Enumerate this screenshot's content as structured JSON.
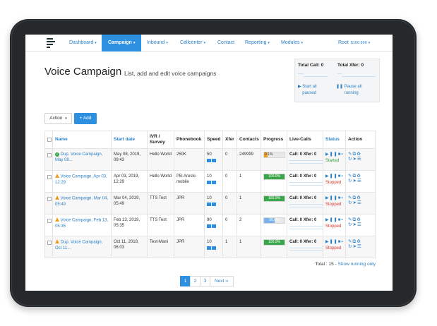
{
  "nav": {
    "items": [
      {
        "label": "Dashboard",
        "caret": true
      },
      {
        "label": "Campaign",
        "caret": true,
        "active": true
      },
      {
        "label": "Inbound",
        "caret": true
      },
      {
        "label": "Callcenter",
        "caret": true
      },
      {
        "label": "Contact",
        "caret": false
      },
      {
        "label": "Reporting",
        "caret": true
      },
      {
        "label": "Modules",
        "caret": true
      }
    ],
    "user": "Root",
    "balance": "$100.999"
  },
  "header": {
    "title": "Voice Campaign",
    "subtitle": "List, add and edit voice campaigns"
  },
  "stats": {
    "total_call_label": "Total Call: 0",
    "total_xfer_label": "Total Xfer: 0",
    "start_all": "Start all paused",
    "pause_all": "Pause all running"
  },
  "toolbar": {
    "action_label": "Action",
    "add_label": "+ Add"
  },
  "table": {
    "headers": [
      "Name",
      "Start date",
      "IVR / Survey",
      "Phonebook",
      "Speed",
      "Xfer",
      "Contacts",
      "Progress",
      "Live-Calls",
      "Status",
      "Action"
    ],
    "rows": [
      {
        "status_icon": "check-icon",
        "name": "Dup. Voice Campaign, May 08...",
        "start_date": "May 08, 2019, 09:43",
        "ivr": "Hello World",
        "phonebook": "250K",
        "speed": "50",
        "xfer": "0",
        "contacts": "249999",
        "progress": 0.1,
        "progress_label": "0.1%",
        "call": "Call: 0",
        "xfer_live": "Xfer: 0",
        "status": "Started",
        "status_kind": "ok"
      },
      {
        "status_icon": "warning-icon",
        "name": "Voice Campaign, Apr 03, 12:29",
        "start_date": "Apr 03, 2019, 12:29",
        "ivr": "Hello World",
        "phonebook": "PB-Areski-mobile",
        "speed": "10",
        "xfer": "0",
        "contacts": "1",
        "progress": 100.0,
        "progress_label": "100.0%",
        "call": "Call: 0",
        "xfer_live": "Xfer: 0",
        "status": "Stopped",
        "status_kind": "stop"
      },
      {
        "status_icon": "warning-icon",
        "name": "Voice Campaign, Mar 04, 05:49",
        "start_date": "Mar 04, 2019, 05:49",
        "ivr": "TTS Test",
        "phonebook": "JPR",
        "speed": "10",
        "xfer": "0",
        "contacts": "1",
        "progress": 100.0,
        "progress_label": "100.0%",
        "call": "Call: 0",
        "xfer_live": "Xfer: 0",
        "status": "Stopped",
        "status_kind": "stop"
      },
      {
        "status_icon": "warning-icon",
        "name": "Voice Campaign, Feb 13, 05:35",
        "start_date": "Feb 13, 2019, 05:35",
        "ivr": "TTS Test",
        "phonebook": "JPR",
        "speed": "90",
        "xfer": "0",
        "contacts": "2",
        "progress": 50.0,
        "progress_label": "50.0%",
        "call": "Call: 0",
        "xfer_live": "Xfer: 0",
        "status": "Stopped",
        "status_kind": "stop"
      },
      {
        "status_icon": "warning-icon",
        "name": "Dup. Voice Campaign, Oct 11...",
        "start_date": "Oct 11, 2018, 06:03",
        "ivr": "Test-Mani",
        "phonebook": "JPR",
        "speed": "10",
        "xfer": "1",
        "contacts": "1",
        "progress": 100.0,
        "progress_label": "100.0%",
        "call": "Call: 0",
        "xfer_live": "Xfer: 0",
        "status": "Stopped",
        "status_kind": "stop"
      }
    ]
  },
  "footer": {
    "total": "Total : 15 -",
    "show_running": "Show running only"
  },
  "pagination": {
    "pages": [
      "1",
      "2",
      "3"
    ],
    "next": "Next ››",
    "active_page": "1"
  },
  "colors": {
    "accent": "#2d8fe0",
    "success": "#3aa64a",
    "danger": "#d8342c",
    "warning": "#f0a020"
  }
}
